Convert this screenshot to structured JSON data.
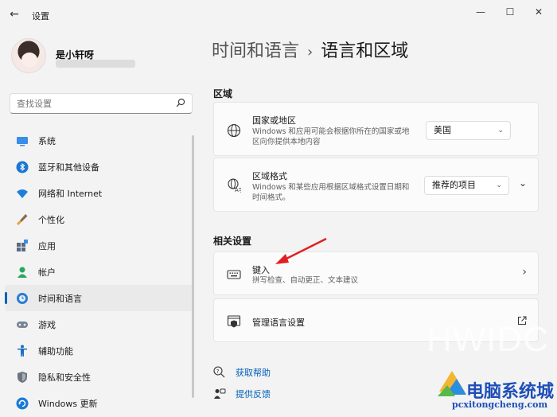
{
  "app": {
    "title": "设置",
    "back_icon": "back-arrow-icon"
  },
  "user": {
    "name": "是小轩呀"
  },
  "search": {
    "placeholder": "查找设置"
  },
  "sidebar": {
    "items": [
      {
        "label": "系统",
        "icon": "system-icon",
        "active": false
      },
      {
        "label": "蓝牙和其他设备",
        "icon": "bluetooth-icon",
        "active": false
      },
      {
        "label": "网络和 Internet",
        "icon": "wifi-icon",
        "active": false
      },
      {
        "label": "个性化",
        "icon": "brush-icon",
        "active": false
      },
      {
        "label": "应用",
        "icon": "apps-icon",
        "active": false
      },
      {
        "label": "帐户",
        "icon": "account-icon",
        "active": false
      },
      {
        "label": "时间和语言",
        "icon": "time-language-icon",
        "active": true
      },
      {
        "label": "游戏",
        "icon": "gamepad-icon",
        "active": false
      },
      {
        "label": "辅助功能",
        "icon": "accessibility-icon",
        "active": false
      },
      {
        "label": "隐私和安全性",
        "icon": "shield-icon",
        "active": false
      },
      {
        "label": "Windows 更新",
        "icon": "update-icon",
        "active": false
      }
    ]
  },
  "breadcrumb": {
    "parent": "时间和语言",
    "separator": "›",
    "current": "语言和区域"
  },
  "region": {
    "title": "区域",
    "country": {
      "title": "国家或地区",
      "desc": "Windows 和应用可能会根据你所在的国家或地区向你提供本地内容",
      "value": "美国"
    },
    "format": {
      "title": "区域格式",
      "desc": "Windows 和某些应用根据区域格式设置日期和时间格式。",
      "value": "推荐的项目"
    }
  },
  "related": {
    "title": "相关设置",
    "typing": {
      "title": "键入",
      "desc": "拼写检查、自动更正、文本建议"
    },
    "manage": {
      "title": "管理语言设置"
    }
  },
  "help": {
    "get_help": "获取帮助",
    "feedback": "提供反馈"
  },
  "watermark": {
    "hw": "HWIDC",
    "cn": "电脑系统城",
    "url": "pcxitongcheng.com"
  },
  "colors": {
    "accent": "#005fb8",
    "arrow": "#e02020",
    "watermark_blue": "#1e4fb8"
  }
}
